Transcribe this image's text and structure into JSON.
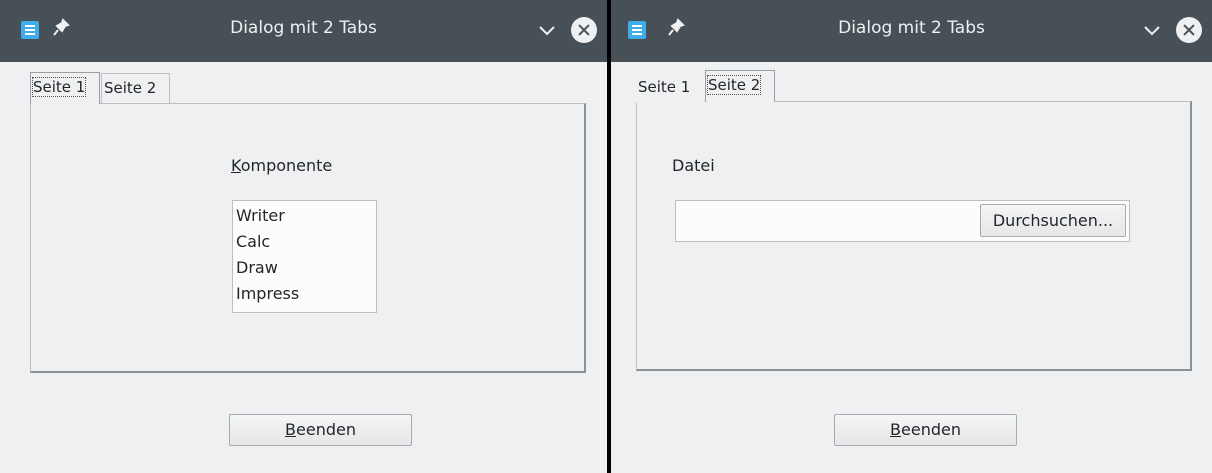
{
  "left_window": {
    "title": "Dialog mit 2 Tabs",
    "tabs": [
      {
        "label": "Seite 1",
        "active": true
      },
      {
        "label": "Seite 2",
        "active": false
      }
    ],
    "component_label_first": "K",
    "component_label_rest": "omponente",
    "list_items": [
      "Writer",
      "Calc",
      "Draw",
      "Impress"
    ],
    "quit_button_first": "B",
    "quit_button_rest": "eenden"
  },
  "right_window": {
    "title": "Dialog mit 2 Tabs",
    "tabs": [
      {
        "label": "Seite 1",
        "active": false
      },
      {
        "label": "Seite 2",
        "active": true
      }
    ],
    "file_label": "Datei",
    "file_value": "",
    "browse_button": "Durchsuchen...",
    "quit_button_first": "B",
    "quit_button_rest": "eenden"
  },
  "colors": {
    "titlebar": "#475057",
    "window_bg": "#eff0f1",
    "separator": "#000000"
  },
  "icons": [
    "app-icon",
    "pin-icon",
    "chevron-down-icon",
    "close-icon"
  ]
}
